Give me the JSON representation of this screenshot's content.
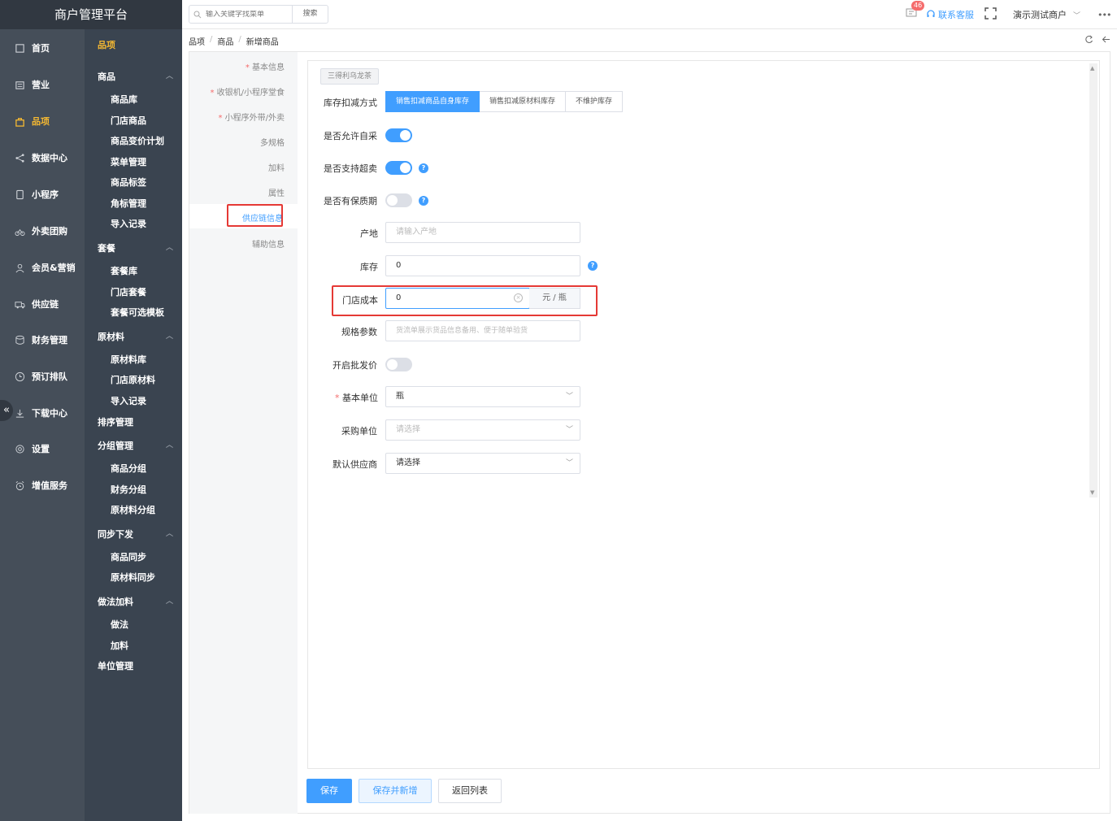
{
  "app": {
    "title": "商户管理平台"
  },
  "nav1": [
    {
      "label": "首页",
      "icon": "home-icon"
    },
    {
      "label": "营业",
      "icon": "business-icon"
    },
    {
      "label": "品项",
      "icon": "bag-icon"
    },
    {
      "label": "数据中心",
      "icon": "share-icon"
    },
    {
      "label": "小程序",
      "icon": "phone-icon"
    },
    {
      "label": "外卖团购",
      "icon": "bike-icon"
    },
    {
      "label": "会员&营销",
      "icon": "user-icon"
    },
    {
      "label": "供应链",
      "icon": "truck-icon"
    },
    {
      "label": "财务管理",
      "icon": "database-icon"
    },
    {
      "label": "预订排队",
      "icon": "clock-icon"
    },
    {
      "label": "下载中心",
      "icon": "download-icon"
    },
    {
      "label": "设置",
      "icon": "gear-icon"
    },
    {
      "label": "增值服务",
      "icon": "alarm-icon"
    }
  ],
  "nav2": {
    "title": "品项",
    "groups": [
      {
        "label": "商品",
        "items": [
          "商品库",
          "门店商品",
          "商品变价计划",
          "菜单管理",
          "商品标签",
          "角标管理",
          "导入记录"
        ]
      },
      {
        "label": "套餐",
        "items": [
          "套餐库",
          "门店套餐",
          "套餐可选模板"
        ]
      },
      {
        "label": "原材料",
        "items": [
          "原材料库",
          "门店原材料",
          "导入记录"
        ]
      },
      {
        "label": "排序管理",
        "items": []
      },
      {
        "label": "分组管理",
        "items": [
          "商品分组",
          "财务分组",
          "原材料分组"
        ]
      },
      {
        "label": "同步下发",
        "items": [
          "商品同步",
          "原材料同步"
        ]
      },
      {
        "label": "做法加料",
        "items": [
          "做法",
          "加料"
        ]
      },
      {
        "label": "单位管理",
        "items": []
      }
    ]
  },
  "topbar": {
    "search_placeholder": "输入关键字找菜单",
    "search_button": "搜索",
    "notification_count": "46",
    "contact_label": "联系客服",
    "merchant_name": "演示测试商户",
    "more": "•••"
  },
  "breadcrumb": [
    "品项",
    "商品",
    "新增商品"
  ],
  "anchors": [
    {
      "label": "基本信息",
      "required": true
    },
    {
      "label": "收银机/小程序堂食",
      "required": true
    },
    {
      "label": "小程序外带/外卖",
      "required": true
    },
    {
      "label": "多规格",
      "required": false
    },
    {
      "label": "加料",
      "required": false
    },
    {
      "label": "属性",
      "required": false
    },
    {
      "label": "供应链信息",
      "required": false,
      "active": true
    },
    {
      "label": "辅助信息",
      "required": false
    }
  ],
  "form": {
    "product_tag": "三得利乌龙茶",
    "stock_mode": {
      "label": "库存扣减方式",
      "options": [
        "销售扣减商品自身库存",
        "销售扣减原材料库存",
        "不维护库存"
      ],
      "selected": 0
    },
    "allow_self_purchase": {
      "label": "是否允许自采",
      "on": true
    },
    "support_oversell": {
      "label": "是否支持超卖",
      "on": true
    },
    "has_shelf_life": {
      "label": "是否有保质期",
      "on": false
    },
    "origin": {
      "label": "产地",
      "placeholder": "请输入产地"
    },
    "stock": {
      "label": "库存",
      "value": "0"
    },
    "store_cost": {
      "label": "门店成本",
      "value": "0",
      "unit": "元 / 瓶"
    },
    "spec_params": {
      "label": "规格参数",
      "placeholder": "货流单展示货品信息备用、便于随单验货"
    },
    "wholesale_price": {
      "label": "开启批发价",
      "on": false
    },
    "base_unit": {
      "label": "基本单位",
      "value": "瓶",
      "required": true
    },
    "purchase_unit": {
      "label": "采购单位",
      "placeholder": "请选择"
    },
    "default_supplier": {
      "label": "默认供应商",
      "value": "请选择"
    },
    "qmark": "?"
  },
  "footer": {
    "save": "保存",
    "save_new": "保存并新增",
    "back": "返回列表"
  },
  "colors": {
    "primary": "#409eff",
    "accent": "#f4b832",
    "danger": "#e53935",
    "nav_dark": "#454e59",
    "nav_sub": "#3a4450"
  }
}
